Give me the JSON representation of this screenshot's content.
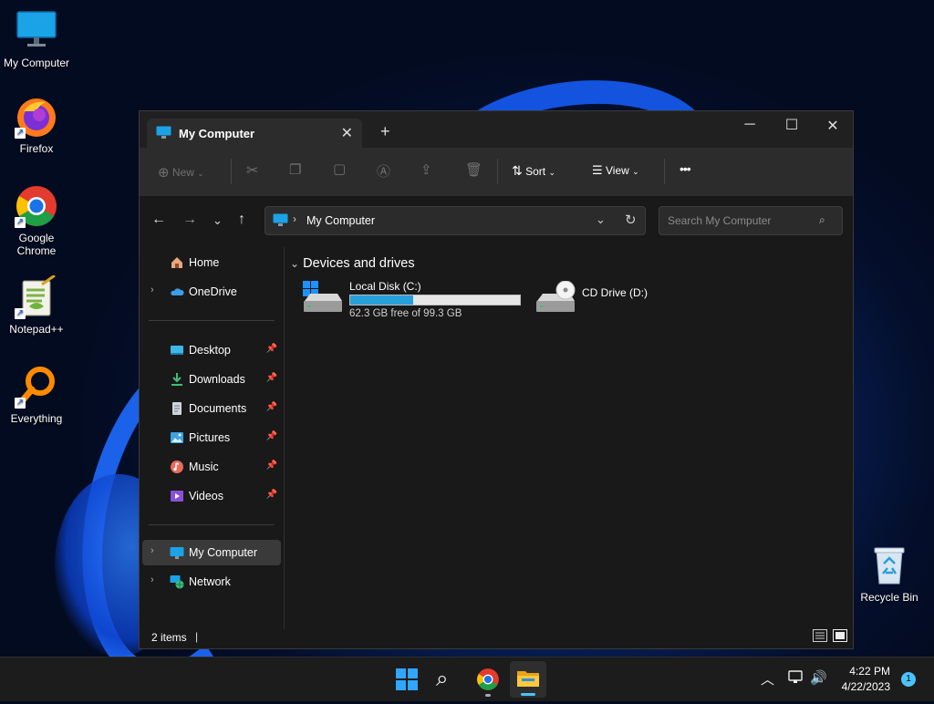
{
  "desktop": {
    "icons": [
      {
        "label": "My Computer"
      },
      {
        "label": "Firefox"
      },
      {
        "label": "Google Chrome"
      },
      {
        "label": "Notepad++"
      },
      {
        "label": "Everything"
      },
      {
        "label": "Recycle Bin"
      }
    ]
  },
  "window": {
    "tab_title": "My Computer",
    "toolbar": {
      "new_label": "New",
      "sort_label": "Sort",
      "view_label": "View",
      "more_label": "•••"
    },
    "address": {
      "path": "My Computer"
    },
    "search": {
      "placeholder": "Search My Computer"
    },
    "sidebar": {
      "items": [
        {
          "label": "Home"
        },
        {
          "label": "OneDrive"
        },
        {
          "label": "Desktop"
        },
        {
          "label": "Downloads"
        },
        {
          "label": "Documents"
        },
        {
          "label": "Pictures"
        },
        {
          "label": "Music"
        },
        {
          "label": "Videos"
        },
        {
          "label": "My Computer"
        },
        {
          "label": "Network"
        }
      ]
    },
    "content": {
      "group_title": "Devices and drives",
      "drives": [
        {
          "name": "Local Disk (C:)",
          "free_text": "62.3 GB free of 99.3 GB",
          "used_fraction": 0.373
        },
        {
          "name": "CD Drive (D:)"
        }
      ]
    },
    "status": {
      "item_count": "2 items"
    }
  },
  "taskbar": {
    "time": "4:22 PM",
    "date": "4/22/2023",
    "notification_count": "1"
  },
  "colors": {
    "accent": "#0078d4",
    "window_bg": "#191919",
    "toolbar_bg": "#2c2c2c"
  }
}
